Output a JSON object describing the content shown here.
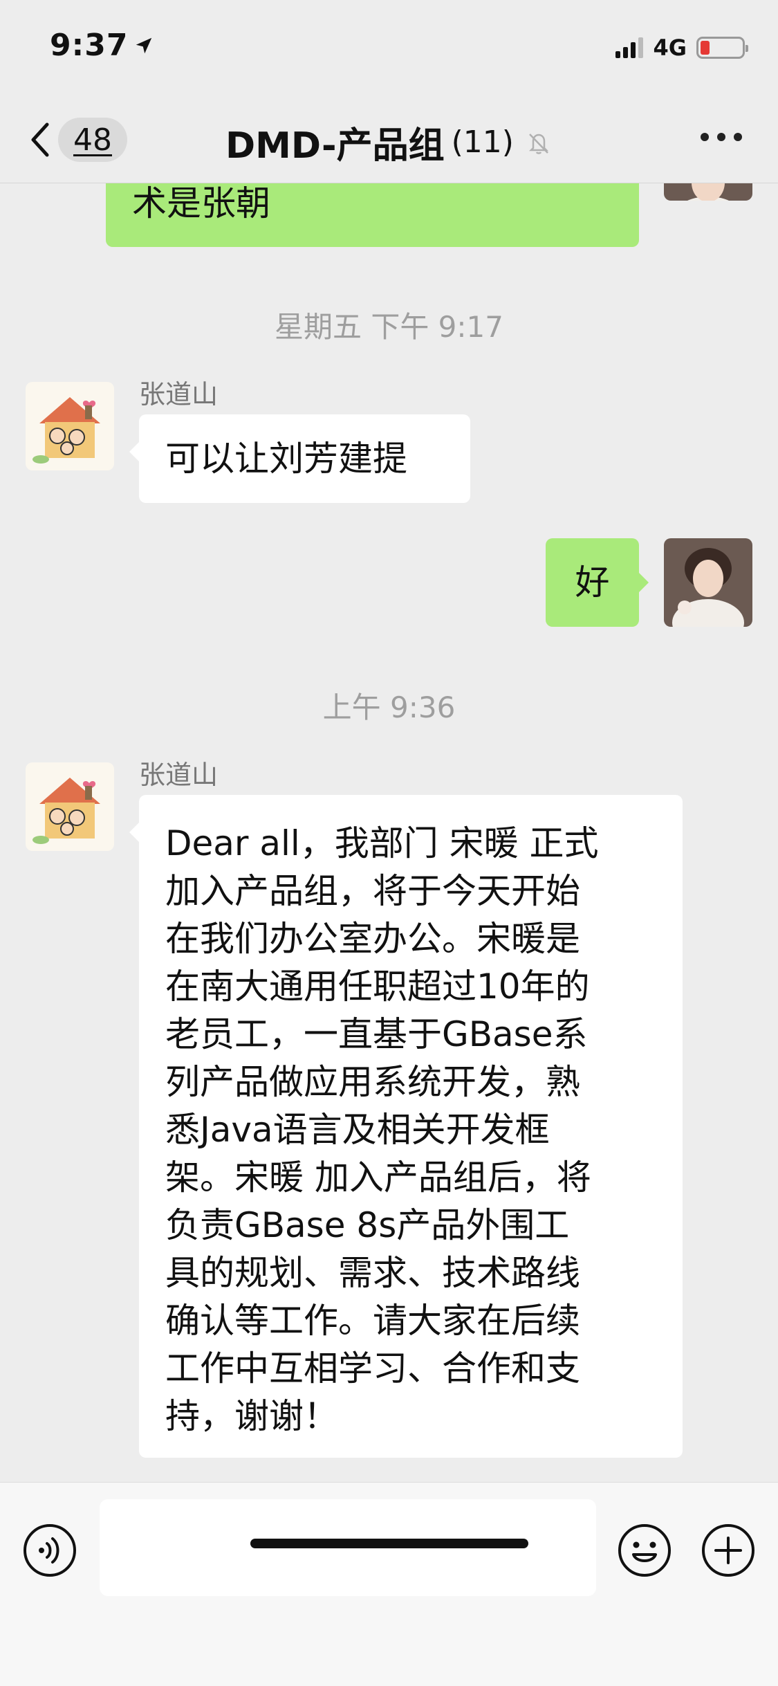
{
  "status_bar": {
    "time": "9:37",
    "network": "4G"
  },
  "nav": {
    "unread_count": "48",
    "title": "DMD-产品组",
    "member_count": "(11)"
  },
  "messages": {
    "m1_text": "术是张朝",
    "ts1": "星期五 下午 9:17",
    "m2_sender": "张道山",
    "m2_text": "可以让刘芳建提",
    "m3_text": "好",
    "ts2": "上午 9:36",
    "m4_sender": "张道山",
    "m4_lines": [
      "Dear all，我部门 宋暖 正式",
      "加入产品组，将于今天开始",
      "在我们办公室办公。宋暖是",
      "在南大通用任职超过10年的",
      "老员工，一直基于GBase系",
      "列产品做应用系统开发，熟",
      "悉Java语言及相关开发框",
      "架。宋暖 加入产品组后，将",
      "负责GBase 8s产品外围工",
      "具的规划、需求、技术路线",
      "确认等工作。请大家在后续",
      "工作中互相学习、合作和支",
      "持，谢谢！"
    ]
  },
  "input": {
    "placeholder": ""
  },
  "colors": {
    "background": "#EDEDED",
    "sent_bubble": "#A9EA7A",
    "received_bubble": "#FFFFFF",
    "battery_low": "#E53935"
  },
  "icons": {
    "back": "chevron-left-icon",
    "mute": "bell-slash-icon",
    "more": "more-dots-icon",
    "voice": "voice-icon",
    "emoji": "smiley-icon",
    "plus": "plus-circle-icon"
  }
}
